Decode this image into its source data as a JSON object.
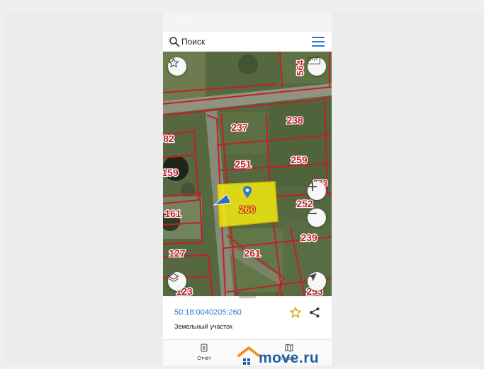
{
  "status": {
    "time": "14:44"
  },
  "search": {
    "placeholder": "Поиск"
  },
  "map": {
    "parcels": [
      "564",
      "237",
      "238",
      "82",
      "251",
      "259",
      "159",
      "252",
      "161",
      "239",
      "127",
      "261",
      "123",
      "253",
      "273"
    ],
    "selected_parcel": "260",
    "highlight_color": "#f2ea12",
    "boundary_color": "#c41e2a"
  },
  "sheet": {
    "cadastral_number": "50:18:0040205:260",
    "property_type": "Земельный участок"
  },
  "tabbar": {
    "tabs": [
      {
        "label": "Отчёт",
        "icon": "report-icon"
      },
      {
        "label": "Планы",
        "icon": "map-plans-icon"
      }
    ]
  },
  "watermark": {
    "text": "move.ru"
  }
}
